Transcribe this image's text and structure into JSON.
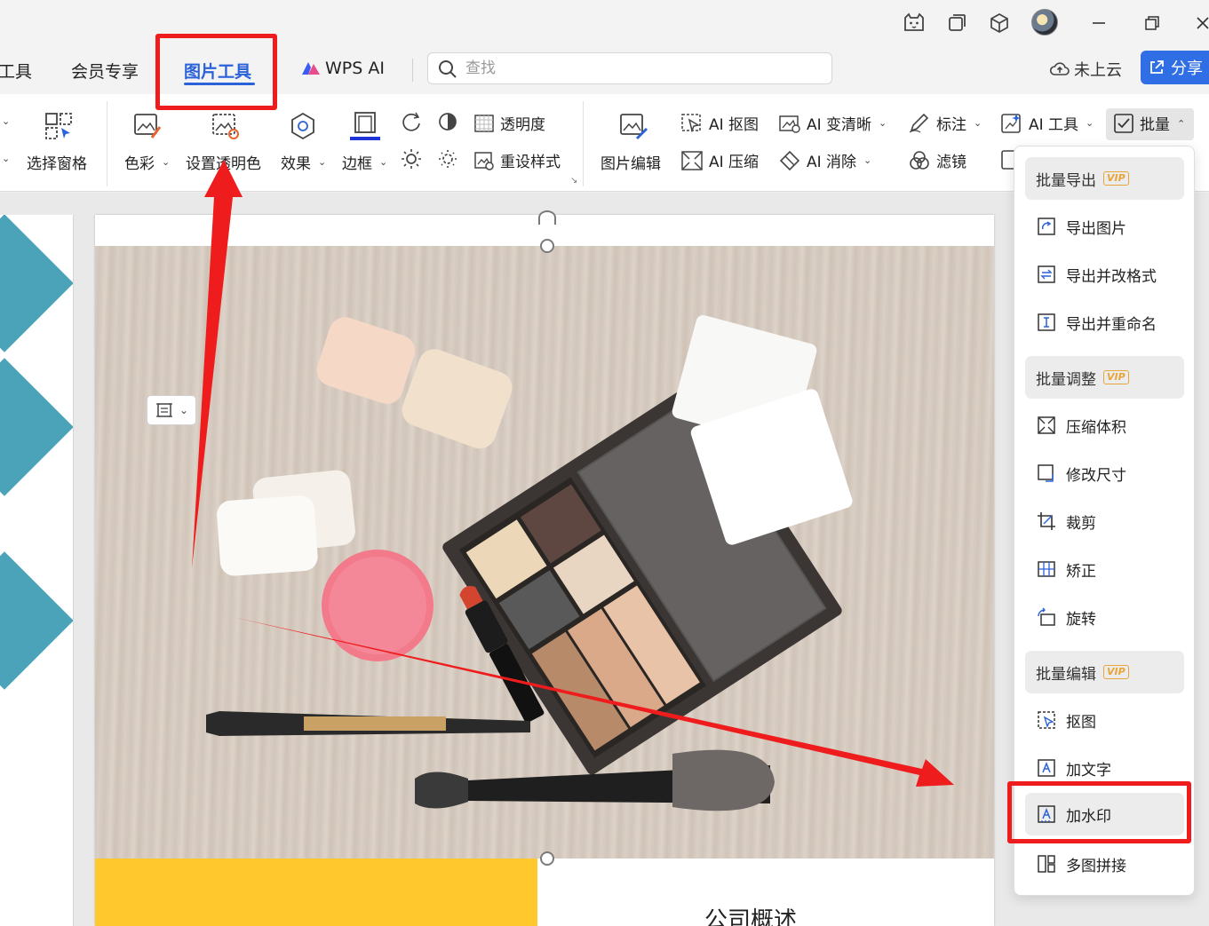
{
  "tabs": {
    "tools_partial": "工具",
    "member": "会员专享",
    "picture_tools": "图片工具",
    "wps_ai": "WPS AI"
  },
  "search": {
    "placeholder": "查找"
  },
  "cloud": {
    "label": "未上云"
  },
  "share": {
    "label": "分享"
  },
  "ribbon": {
    "selection_pane": "选择窗格",
    "color": "色彩",
    "set_transparent_color": "设置透明色",
    "effects": "效果",
    "border": "边框",
    "transparency": "透明度",
    "reset_style": "重设样式",
    "picture_edit": "图片编辑",
    "ai_cutout": "AI 抠图",
    "ai_compress": "AI 压缩",
    "ai_sharpen": "AI 变清晰",
    "ai_erase": "AI 消除",
    "annotate": "标注",
    "filter": "滤镜",
    "ai_tools": "AI 工具",
    "batch": "批量"
  },
  "menu": {
    "vip_badge": "VIP",
    "groups": {
      "batch_export": "批量导出",
      "batch_adjust": "批量调整",
      "batch_edit": "批量编辑"
    },
    "items": {
      "export_image": "导出图片",
      "export_format": "导出并改格式",
      "export_rename": "导出并重命名",
      "compress": "压缩体积",
      "resize": "修改尺寸",
      "crop": "裁剪",
      "correct": "矫正",
      "rotate": "旋转",
      "cutout": "抠图",
      "add_text": "加文字",
      "add_watermark": "加水印",
      "collage": "多图拼接"
    }
  },
  "slide": {
    "title": "公司概述"
  },
  "colors": {
    "accent": "#2b62d9",
    "annotation_red": "#ee1c1c",
    "share_blue": "#2f6ee5",
    "slide_teal": "#4aa3b8",
    "slide_yellow": "#ffc92e"
  }
}
